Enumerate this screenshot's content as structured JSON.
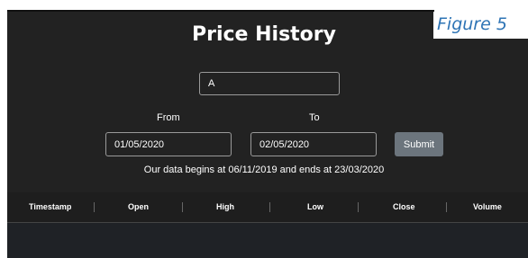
{
  "figure_label": "Figure 5",
  "page_title": "Price History",
  "symbol_input": {
    "value": "A"
  },
  "date_range": {
    "from_label": "From",
    "to_label": "To",
    "from_value": "01/05/2020",
    "to_value": "02/05/2020",
    "submit_label": "Submit"
  },
  "data_range_text": "Our data begins at 06/11/2019 and ends at 23/03/2020",
  "table": {
    "columns": [
      "Timestamp",
      "Open",
      "High",
      "Low",
      "Close",
      "Volume"
    ],
    "rows": []
  }
}
